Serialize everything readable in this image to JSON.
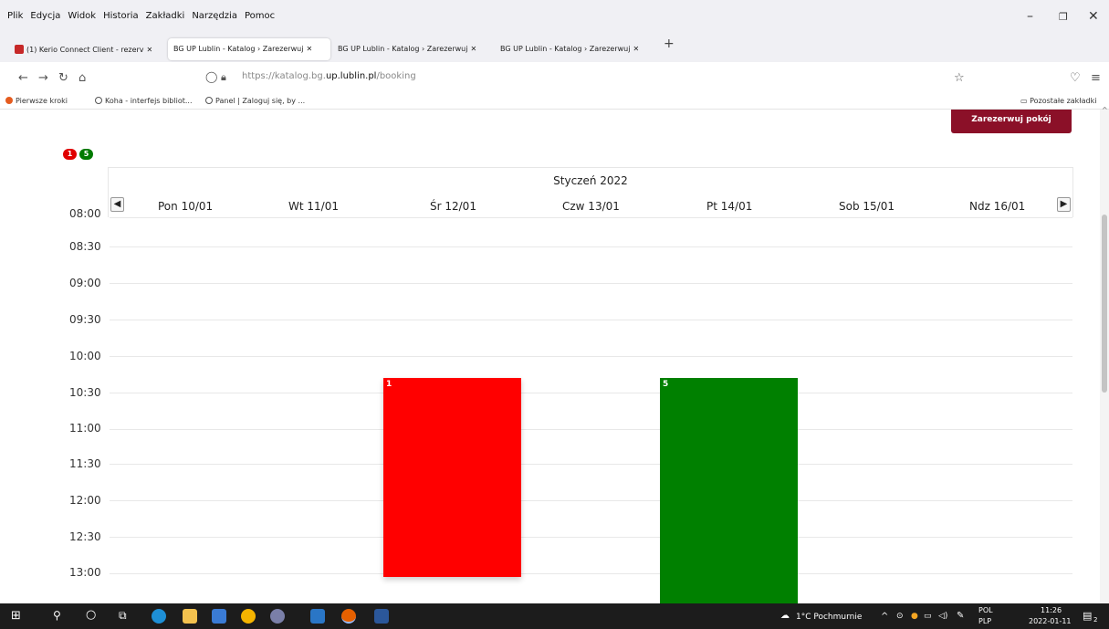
{
  "browser": {
    "menu": [
      "Plik",
      "Edycja",
      "Widok",
      "Historia",
      "Zakładki",
      "Narzędzia",
      "Pomoc"
    ],
    "tabs": [
      {
        "label": "(1) Kerio Connect Client - rezerv",
        "active": false
      },
      {
        "label": "BG UP Lublin - Katalog › Zarezerwuj",
        "active": true
      },
      {
        "label": "BG UP Lublin - Katalog › Zarezerwuj",
        "active": false
      },
      {
        "label": "BG UP Lublin - Katalog › Zarezerwuj",
        "active": false
      }
    ],
    "url_prefix": "https://katalog.bg.",
    "url_domain": "up.lublin.pl",
    "url_path": "/booking",
    "bookmarks": [
      "Pierwsze kroki",
      "Koha - interfejs bibliot...",
      "Panel | Zaloguj się, by ..."
    ],
    "other_bookmarks": "Pozostałe zakładki"
  },
  "page": {
    "reserve_button": "Zarezerwuj pokój",
    "legend": [
      {
        "label": "1",
        "color": "#e00000"
      },
      {
        "label": "5",
        "color": "#007a00"
      }
    ],
    "month": "Styczeń 2022",
    "days": [
      "Pon 10/01",
      "Wt 11/01",
      "Śr 12/01",
      "Czw 13/01",
      "Pt 14/01",
      "Sob 15/01",
      "Ndz 16/01"
    ],
    "times": [
      "08:00",
      "08:30",
      "09:00",
      "09:30",
      "10:00",
      "10:30",
      "11:00",
      "11:30",
      "12:00",
      "12:30",
      "13:00"
    ],
    "events": [
      {
        "label": "1",
        "day": "Śr 12/01",
        "start": "10:15",
        "end": "13:00",
        "color": "#ff0000"
      },
      {
        "label": "5",
        "day": "Pt 14/01",
        "start": "10:15",
        "end": "13:00+",
        "color": "#008000"
      }
    ]
  },
  "taskbar": {
    "weather": "1°C Pochmurnie",
    "lang_top": "POL",
    "lang_bottom": "PLP",
    "time": "11:26",
    "date": "2022-01-11",
    "notifications": "2"
  }
}
